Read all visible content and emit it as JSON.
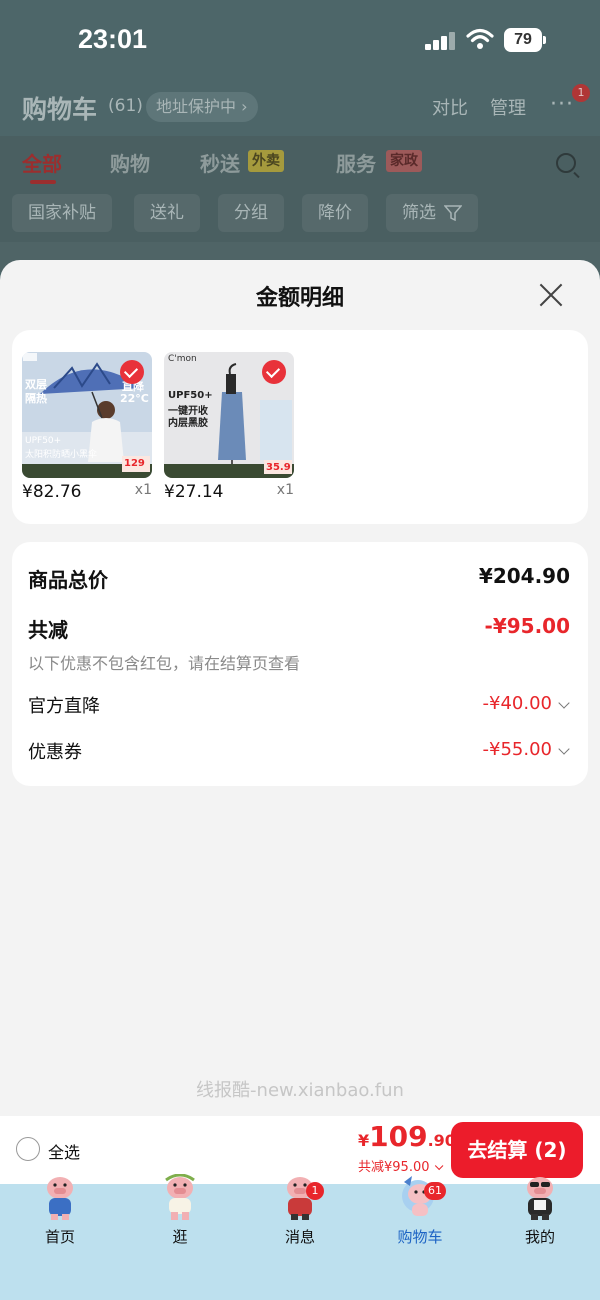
{
  "status_bar": {
    "time": "23:01",
    "battery": "79"
  },
  "header": {
    "title": "购物车",
    "count": "(61)",
    "address": "地址保护中 ›",
    "compare": "对比",
    "manage": "管理",
    "notif_count": "1"
  },
  "tabs": [
    {
      "label": "全部",
      "badge": ""
    },
    {
      "label": "购物",
      "badge": ""
    },
    {
      "label": "秒送",
      "badge": "外卖"
    },
    {
      "label": "服务",
      "badge": "家政"
    }
  ],
  "chips": [
    "国家补贴",
    "送礼",
    "分组",
    "降价",
    "筛选"
  ],
  "sheet": {
    "title": "金额明细",
    "products": [
      {
        "price": "¥82.76",
        "qty": "x1",
        "img_lines": [
          "双层",
          "隔热",
          "直降",
          "22°C",
          "UPF50+",
          "太阳积防晒小黑伞"
        ],
        "img_price": "129"
      },
      {
        "price": "¥27.14",
        "qty": "x1",
        "img_lines": [
          "C'mon",
          "UPF50+",
          "一键开收",
          "内层黑胶"
        ],
        "img_price": "35.9"
      }
    ],
    "summary": {
      "total_label": "商品总价",
      "total_value": "¥204.90",
      "discount_label": "共减",
      "discount_value": "-¥95.00",
      "discount_note": "以下优惠不包含红包，请在结算页查看",
      "rows": [
        {
          "label": "官方直降",
          "value": "-¥40.00"
        },
        {
          "label": "优惠券",
          "value": "-¥55.00"
        }
      ]
    },
    "watermark": "线报酷-new.xianbao.fun"
  },
  "checkout": {
    "select_all": "全选",
    "currency": "¥",
    "price_int": "109",
    "price_dec": ".90",
    "discount": "共减¥95.00",
    "button": "去结算 (2)"
  },
  "nav": [
    {
      "label": "首页",
      "badge": ""
    },
    {
      "label": "逛",
      "badge": ""
    },
    {
      "label": "消息",
      "badge": "1"
    },
    {
      "label": "购物车",
      "badge": "61"
    },
    {
      "label": "我的",
      "badge": ""
    }
  ],
  "colors": {
    "accent_red": "#e8262b",
    "checkout_btn": "#ec1c2b",
    "nav_active": "#1c63c4",
    "nav_bg": "#bde0ee"
  }
}
